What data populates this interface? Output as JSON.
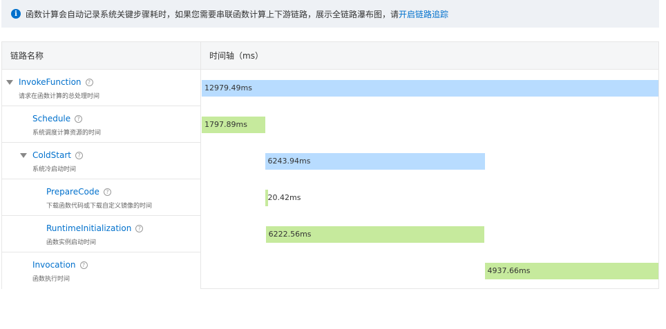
{
  "notice": {
    "icon": "info-icon",
    "text": "函数计算会自动记录系统关键步骤耗时，如果您需要串联函数计算上下游链路，展示全链路瀑布图，请",
    "link": "开启链路追踪"
  },
  "table": {
    "col_name": "链路名称",
    "col_time": "时间轴（ms）"
  },
  "total_ms": 12979.49,
  "rows": [
    {
      "title": "InvokeFunction",
      "desc": "请求在函数计算的总处理时间",
      "level": 0,
      "expandable": true,
      "start_ms": 0,
      "duration_ms": 12979.49,
      "label": "12979.49ms",
      "color": "#b8dcff"
    },
    {
      "title": "Schedule",
      "desc": "系统调度计算资源的时间",
      "level": 1,
      "expandable": false,
      "start_ms": 0,
      "duration_ms": 1797.89,
      "label": "1797.89ms",
      "color": "#c6ea9d"
    },
    {
      "title": "ColdStart",
      "desc": "系统冷启动时间",
      "level": 1,
      "expandable": true,
      "start_ms": 1797.89,
      "duration_ms": 6243.94,
      "label": "6243.94ms",
      "color": "#b8dcff"
    },
    {
      "title": "PrepareCode",
      "desc": "下载函数代码或下载自定义镜像的时间",
      "level": 2,
      "expandable": false,
      "start_ms": 1797.89,
      "duration_ms": 20.42,
      "label": "20.42ms",
      "color": "#c6ea9d"
    },
    {
      "title": "RuntimeInitialization",
      "desc": "函数实例启动时间",
      "level": 2,
      "expandable": false,
      "start_ms": 1818.31,
      "duration_ms": 6222.56,
      "label": "6222.56ms",
      "color": "#c6ea9d"
    },
    {
      "title": "Invocation",
      "desc": "函数执行时间",
      "level": 1,
      "expandable": false,
      "start_ms": 8041.83,
      "duration_ms": 4937.66,
      "label": "4937.66ms",
      "color": "#c6ea9d"
    }
  ]
}
